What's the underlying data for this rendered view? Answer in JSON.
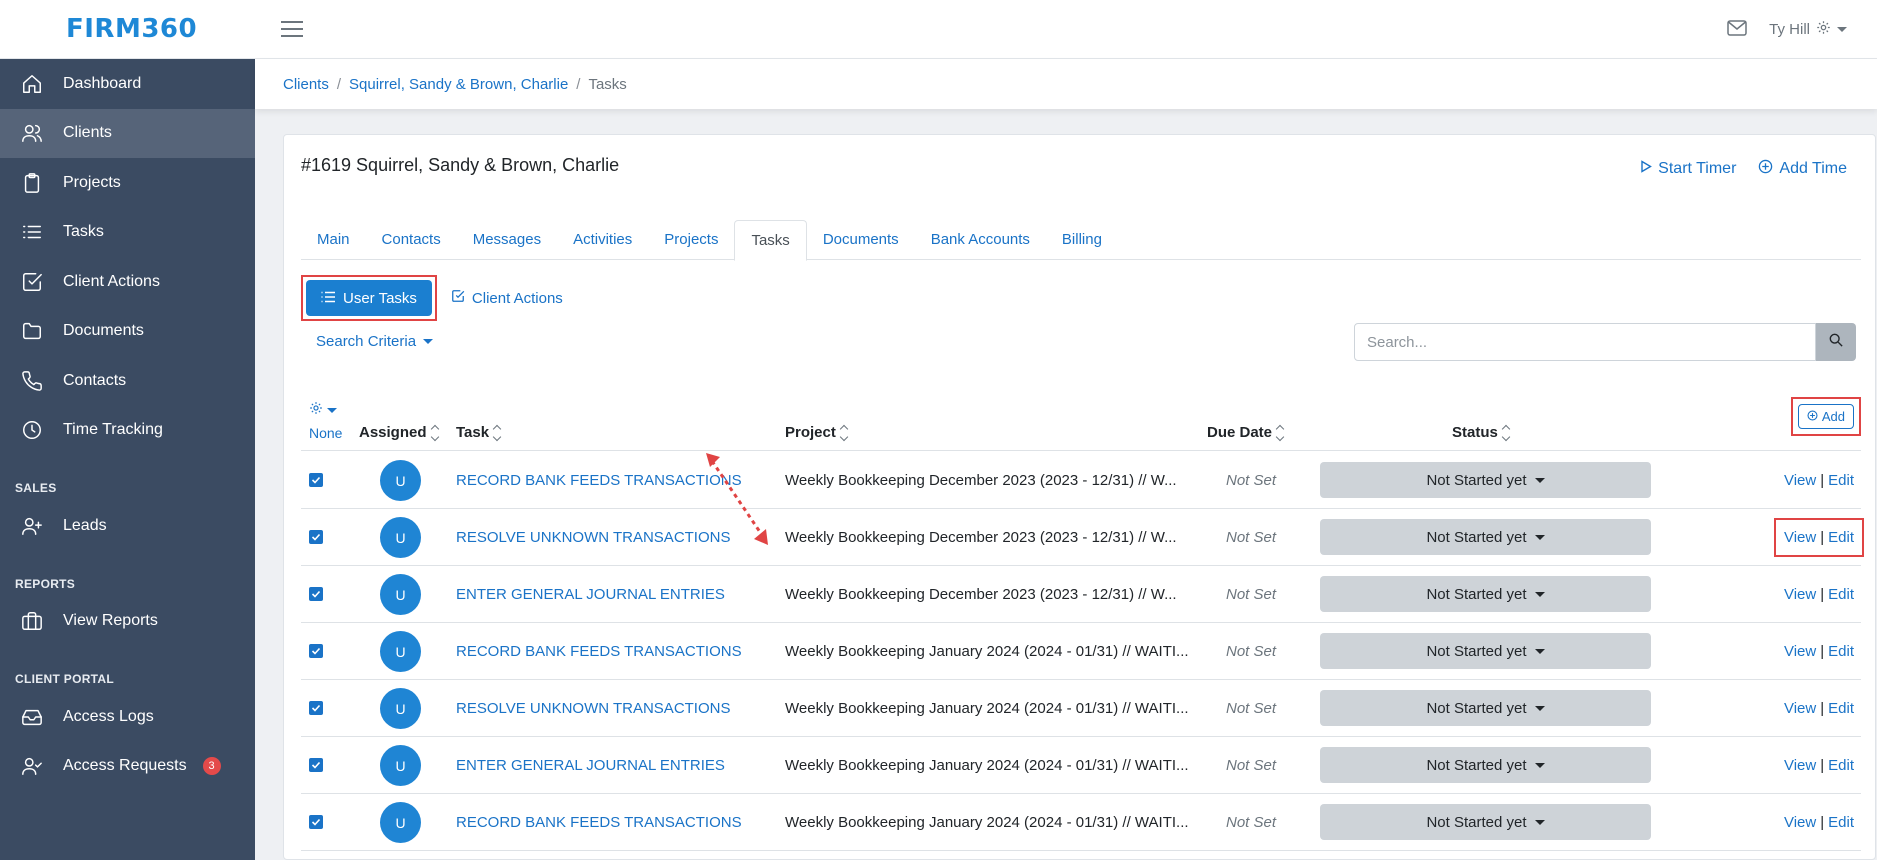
{
  "brand": {
    "logo": "FIRM360"
  },
  "topbar": {
    "user_name": "Ty Hill"
  },
  "sidebar": {
    "items": [
      {
        "label": "Dashboard",
        "icon": "home-icon"
      },
      {
        "label": "Clients",
        "icon": "users-icon",
        "active": true
      },
      {
        "label": "Projects",
        "icon": "clipboard-icon"
      },
      {
        "label": "Tasks",
        "icon": "list-icon"
      },
      {
        "label": "Client Actions",
        "icon": "check-square-icon"
      },
      {
        "label": "Documents",
        "icon": "folder-icon"
      },
      {
        "label": "Contacts",
        "icon": "phone-icon"
      },
      {
        "label": "Time Tracking",
        "icon": "clock-icon"
      }
    ],
    "sales_section": "SALES",
    "sales_items": [
      {
        "label": "Leads",
        "icon": "user-plus-icon"
      }
    ],
    "reports_section": "REPORTS",
    "reports_items": [
      {
        "label": "View Reports",
        "icon": "briefcase-icon"
      }
    ],
    "portal_section": "CLIENT PORTAL",
    "portal_items": [
      {
        "label": "Access Logs",
        "icon": "inbox-icon"
      },
      {
        "label": "Access Requests",
        "icon": "user-check-icon",
        "badge": "3"
      }
    ]
  },
  "breadcrumb": {
    "root": "Clients",
    "client": "Squirrel, Sandy & Brown, Charlie",
    "current": "Tasks"
  },
  "client": {
    "title": "#1619 Squirrel, Sandy & Brown, Charlie",
    "start_timer": "Start Timer",
    "add_time": "Add Time"
  },
  "tabs": [
    "Main",
    "Contacts",
    "Messages",
    "Activities",
    "Projects",
    "Tasks",
    "Documents",
    "Bank Accounts",
    "Billing"
  ],
  "active_tab": "Tasks",
  "subtabs": {
    "user_tasks": "User Tasks",
    "client_actions": "Client Actions"
  },
  "search": {
    "criteria_label": "Search Criteria",
    "placeholder": "Search..."
  },
  "table": {
    "select_none": "None",
    "headers": {
      "assigned": "Assigned",
      "task": "Task",
      "project": "Project",
      "due_date": "Due Date",
      "status": "Status"
    },
    "add_label": "Add",
    "view_label": "View",
    "edit_label": "Edit",
    "rows": [
      {
        "avatar": "U",
        "task": "RECORD BANK FEEDS TRANSACTIONS",
        "project": "Weekly Bookkeeping December 2023 (2023 - 12/31) // W...",
        "due": "Not Set",
        "status": "Not Started yet"
      },
      {
        "avatar": "U",
        "task": "RESOLVE UNKNOWN TRANSACTIONS",
        "project": "Weekly Bookkeeping December 2023 (2023 - 12/31) // W...",
        "due": "Not Set",
        "status": "Not Started yet"
      },
      {
        "avatar": "U",
        "task": "ENTER GENERAL JOURNAL ENTRIES",
        "project": "Weekly Bookkeeping December 2023 (2023 - 12/31) // W...",
        "due": "Not Set",
        "status": "Not Started yet"
      },
      {
        "avatar": "U",
        "task": "RECORD BANK FEEDS TRANSACTIONS",
        "project": "Weekly Bookkeeping January 2024 (2024 - 01/31) // WAITI...",
        "due": "Not Set",
        "status": "Not Started yet"
      },
      {
        "avatar": "U",
        "task": "RESOLVE UNKNOWN TRANSACTIONS",
        "project": "Weekly Bookkeeping January 2024 (2024 - 01/31) // WAITI...",
        "due": "Not Set",
        "status": "Not Started yet"
      },
      {
        "avatar": "U",
        "task": "ENTER GENERAL JOURNAL ENTRIES",
        "project": "Weekly Bookkeeping January 2024 (2024 - 01/31) // WAITI...",
        "due": "Not Set",
        "status": "Not Started yet"
      },
      {
        "avatar": "U",
        "task": "RECORD BANK FEEDS TRANSACTIONS",
        "project": "Weekly Bookkeeping January 2024 (2024 - 01/31) // WAITI...",
        "due": "Not Set",
        "status": "Not Started yet"
      }
    ]
  },
  "colors": {
    "sidebar": "#3b4b62",
    "accent": "#1a73c7",
    "highlight": "#e04444"
  }
}
